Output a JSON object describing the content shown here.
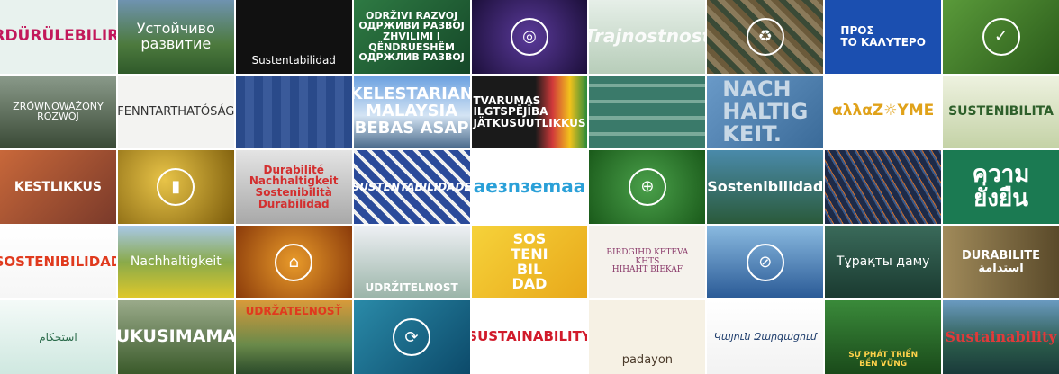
{
  "tiles": [
    {
      "label": "SÜRDÜRÜLEBILIRLIK",
      "icon": "",
      "bg": "#e8f2ee",
      "fg": "#c2185b"
    },
    {
      "label": "Устойчиво\nразвитие",
      "icon": "",
      "bg": "#3b6b3a",
      "fg": "#ffffff"
    },
    {
      "label": "Sustentabilidad",
      "icon": "",
      "bg": "#111111",
      "fg": "#ffffff"
    },
    {
      "label": "ODRŽIVI RAZVOJ\nОДРЖИВИ РАЗВОЈ\nZHVILIMI I QËNDRUESHËM\nОДРЖЛИВ РАЗВОЈ",
      "icon": "",
      "bg": "#1f5a34",
      "fg": "#ffffff"
    },
    {
      "label": "",
      "icon": "glass-icon",
      "bg": "#2a1a55",
      "fg": "#ffffff"
    },
    {
      "label": "Trajnostnost",
      "icon": "",
      "bg": "#d9e4dc",
      "fg": "#ffffff"
    },
    {
      "label": "",
      "icon": "recycle-icon",
      "bg": "#3a4036",
      "fg": "#ffffff"
    },
    {
      "label": "ΠΡΟΣ\nΤΟ ΚΑΛΥΤΕΡΟ",
      "icon": "",
      "bg": "#1b4fb0",
      "fg": "#ffffff"
    },
    {
      "label": "",
      "icon": "head-check-icon",
      "bg": "#3d7a2a",
      "fg": "#ffffff"
    },
    {
      "label": "ZRÓWNOWAŻONY ROZWÓJ",
      "icon": "",
      "bg": "#4c5a48",
      "fg": "#ffffff"
    },
    {
      "label": "FENNTARTHATÓSÁG",
      "icon": "",
      "bg": "#f3f3f1",
      "fg": "#333333"
    },
    {
      "label": "",
      "icon": "",
      "bg": "#1e3b7a",
      "fg": "#ffffff"
    },
    {
      "label": "KELESTARIAN\nMALAYSIA BEBAS ASAP",
      "icon": "",
      "bg": "#2d4f8c",
      "fg": "#ffffff"
    },
    {
      "label": "TVARUMAS\nILGTSPĒJĪBA\nJÄTKUSUUTLIKKUS",
      "icon": "",
      "bg": "#1a1a1a",
      "fg": "#ffffff"
    },
    {
      "label": "",
      "icon": "",
      "bg": "#2f6a6a",
      "fg": "#ffffff"
    },
    {
      "label": "NACH\nHALTIG\nKEIT.",
      "icon": "",
      "bg": "#4f7ea8",
      "fg": "#c8d8e6"
    },
    {
      "label": "αλλαΖ☼ΥΜΕ",
      "icon": "",
      "bg": "#ffffff",
      "fg": "#e0a21a"
    },
    {
      "label": "SUSTENIBILITA",
      "icon": "",
      "bg": "#d9e2c6",
      "fg": "#2e5f2a"
    },
    {
      "label": "KESTLIKKUS",
      "icon": "",
      "bg": "#a4492e",
      "fg": "#ffffff"
    },
    {
      "label": "",
      "icon": "chart-icon",
      "bg": "#a07f12",
      "fg": "#ffffff"
    },
    {
      "label": "Durabilité\nNachhaltigkeit\nSostenibilità\nDurabilidad",
      "icon": "",
      "bg": "#c9c9c9",
      "fg": "#d32f2f"
    },
    {
      "label": "SUSTENTABILIDADE",
      "icon": "",
      "bg": "#2f4a8e",
      "fg": "#ffffff"
    },
    {
      "label": "aeɜnɜemaa",
      "icon": "",
      "bg": "#ffffff",
      "fg": "#2aa0d8"
    },
    {
      "label": "",
      "icon": "globe-plant-icon",
      "bg": "#2f7c38",
      "fg": "#ffffff"
    },
    {
      "label": "Sostenibilidad",
      "icon": "",
      "bg": "#2c5f6f",
      "fg": "#ffffff"
    },
    {
      "label": "",
      "icon": "",
      "bg": "#1d2a48",
      "fg": "#ffffff"
    },
    {
      "label": "ความ\nยั่งยืน",
      "icon": "",
      "bg": "#1b7a52",
      "fg": "#ffffff"
    },
    {
      "label": "SOSTENIBILIDAD",
      "icon": "",
      "bg": "#ffffff",
      "fg": "#e03a1e"
    },
    {
      "label": "Nachhaltigkeit",
      "icon": "",
      "bg": "#6a8c3a",
      "fg": "#ffffff"
    },
    {
      "label": "",
      "icon": "factory-icon",
      "bg": "#b85a12",
      "fg": "#ffffff"
    },
    {
      "label": "UDRŽITELNOST",
      "icon": "",
      "bg": "#e4e6ea",
      "fg": "#ffffff"
    },
    {
      "label": "SOS\nTENI\nBIL\nDAD",
      "icon": "",
      "bg": "#f2c21c",
      "fg": "#ffffff"
    },
    {
      "label": "BIRDGIHD  KETEVA\nKHTS\nHIHAHT  BIEKAF",
      "icon": "",
      "bg": "#f5f2ec",
      "fg": "#8a3a6a"
    },
    {
      "label": "",
      "icon": "no-smoking-icon",
      "bg": "#3b79b6",
      "fg": "#ffffff"
    },
    {
      "label": "Тұрақты даму",
      "icon": "",
      "bg": "#2d5a4f",
      "fg": "#ffffff"
    },
    {
      "label": "DURABILITE\nاستدامة",
      "icon": "",
      "bg": "#7a6a48",
      "fg": "#ffffff"
    },
    {
      "label": "استحکام",
      "icon": "",
      "bg": "#eaf4f2",
      "fg": "#2a6a4a"
    },
    {
      "label": "UKUSIMAMA",
      "icon": "",
      "bg": "#6c8a5a",
      "fg": "#ffffff"
    },
    {
      "label": "UDRŽATEĽNOSŤ",
      "icon": "",
      "bg": "#7a6a3a",
      "fg": "#e03a1e"
    },
    {
      "label": "",
      "icon": "globe-arrows-icon",
      "bg": "#1c6f8c",
      "fg": "#ffffff"
    },
    {
      "label": "SUSTAINABILITY",
      "icon": "",
      "bg": "#ffffff",
      "fg": "#d11a2a"
    },
    {
      "label": "padayon",
      "icon": "",
      "bg": "#f6f1e4",
      "fg": "#4a3a2a"
    },
    {
      "label": "Կայուն Զարգացում",
      "icon": "",
      "bg": "#ffffff",
      "fg": "#1b3a6a"
    },
    {
      "label": "SỰ PHÁT TRIỂN\nBỀN VỮNG",
      "icon": "",
      "bg": "#2a6a2a",
      "fg": "#ffd24a"
    },
    {
      "label": "Sustainability",
      "icon": "",
      "bg": "#2c5a7a",
      "fg": "#e03a3a"
    }
  ]
}
